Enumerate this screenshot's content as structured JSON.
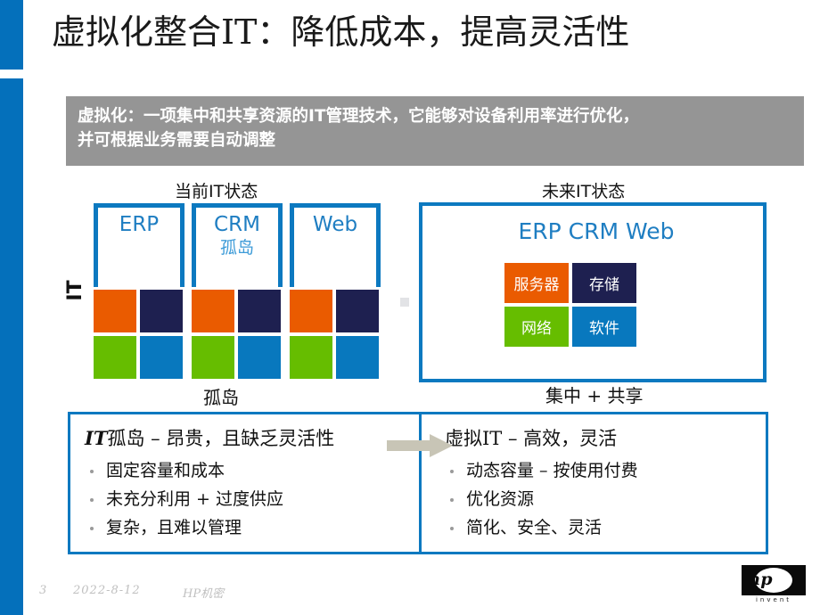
{
  "slide": {
    "title": "虚拟化整合IT：降低成本，提高灵活性",
    "accent_color": "#0470BB",
    "banner": {
      "background": "#959595",
      "line1": "虚拟化：一项集中和共享资源的IT管理技术，它能够对设备利用率进行优化，",
      "line2": "并可根据业务需要自动调整"
    }
  },
  "palette": {
    "orange": "#EA5B00",
    "navy": "#1E2050",
    "green": "#66BD00",
    "blue": "#0878BE",
    "border_blue": "#0C79C0",
    "text_blue": "#1F7EC2",
    "sub_blue": "#3D9BD8",
    "arrow_gray": "#C8C5B6"
  },
  "current_state": {
    "caption": "当前IT状态",
    "axis_label": "IT",
    "bottom_label": "孤岛",
    "silos": [
      {
        "name": "ERP",
        "sub": ""
      },
      {
        "name": "CRM",
        "sub": "孤岛"
      },
      {
        "name": "Web",
        "sub": ""
      }
    ],
    "tile_colors": [
      "#EA5B00",
      "#1E2050",
      "#66BD00",
      "#0878BE"
    ]
  },
  "future_state": {
    "caption": "未来IT状态",
    "header": "ERP  CRM  Web",
    "bottom_label": "集中 + 共享",
    "tiles": [
      {
        "label": "服务器",
        "color": "#EA5B00"
      },
      {
        "label": "存储",
        "color": "#1E2050"
      },
      {
        "label": "网络",
        "color": "#66BD00"
      },
      {
        "label": "软件",
        "color": "#0878BE"
      }
    ]
  },
  "comparison": {
    "arrow": "right-arrow",
    "left": {
      "heading_em": "IT",
      "heading_rest": "孤岛 – 昂贵，且缺乏灵活性",
      "bullets": [
        "固定容量和成本",
        "未充分利用 + 过度供应",
        "复杂，且难以管理"
      ]
    },
    "right": {
      "heading_em": "虚拟IT",
      "heading_rest": " – 高效，灵活",
      "bullets": [
        "动态容量 – 按使用付费",
        "优化资源",
        "简化、安全、灵活"
      ]
    }
  },
  "footer": {
    "page_number": "3",
    "date": "2022-8-12",
    "confidential": "HP机密",
    "logo": {
      "wordmark": "hp",
      "tagline": "invent"
    }
  }
}
